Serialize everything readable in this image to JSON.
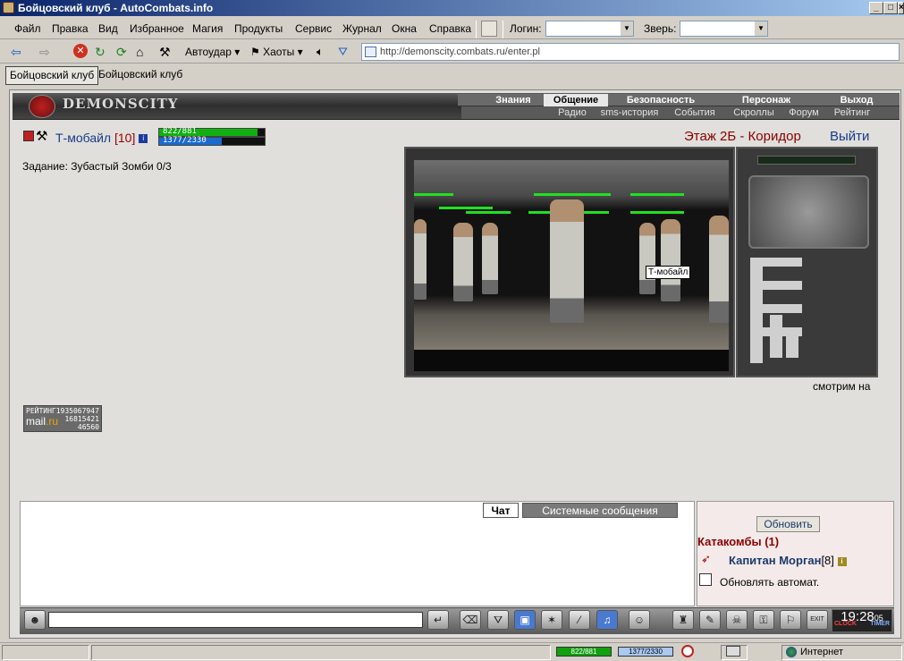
{
  "window": {
    "title": "Бойцовский клуб - AutoCombats.info"
  },
  "menu": {
    "items": [
      "Файл",
      "Правка",
      "Вид",
      "Избранное",
      "Магия",
      "Продукты",
      "Сервис",
      "Журнал",
      "Окна",
      "Справка"
    ],
    "login_label": "Логин:",
    "login_value": "",
    "beast_label": "Зверь:",
    "beast_value": ""
  },
  "toolbar": {
    "autohit_label": "Автоудар",
    "chaos_label": "Хаоты",
    "address": "http://demonscity.combats.ru/enter.pl"
  },
  "tabs": [
    "Бойцовский клуб",
    "Бойцовский клуб"
  ],
  "header": {
    "logo": "DEMONSCITY",
    "nav_top": [
      "Знания",
      "Общение",
      "Безопасность",
      "Персонаж",
      "Выход"
    ],
    "nav_top_active": "Общение",
    "nav_bottom": [
      "Радио",
      "sms-история",
      "События",
      "Скроллы",
      "Форум",
      "Рейтинг"
    ]
  },
  "character": {
    "name": "Т-мобайл",
    "level": "[10]",
    "info": "i",
    "hp": "822/881",
    "hp_fraction": 0.933,
    "mana": "1377/2330",
    "mana_fraction": 0.591
  },
  "task": "Задание: Зубастый Зомби 0/3",
  "location": "Этаж 2Б - Коридор",
  "exit_label": "Выйти",
  "dungeon": {
    "tooltip": "Т-мобайл"
  },
  "watching": "смотрим на",
  "counter": {
    "label": "РЕЙТИНГ",
    "top": "1935067947",
    "mail": "mail",
    "ru": ".ru",
    "n1": "16815421",
    "n2": "46560"
  },
  "chat": {
    "tab_chat": "Чат",
    "tab_system": "Системные сообщения",
    "refresh_label": "Обновить",
    "room": "Катакомбы (1)",
    "member_name": "Капитан Морган",
    "member_level": "[8]",
    "auto_refresh_label": "Обновлять автомат."
  },
  "clock": {
    "time": "19:28",
    "seconds": "05",
    "clock_label": "CLOCK",
    "timer_label": "TIMER"
  },
  "statusbar": {
    "hp": "822/881",
    "mana": "1377/2330",
    "zone": "Интернет"
  },
  "colors": {
    "accent": "#1a3a8a",
    "danger": "#8a0000",
    "hp": "#10b010",
    "mana": "#1a6ad0"
  }
}
